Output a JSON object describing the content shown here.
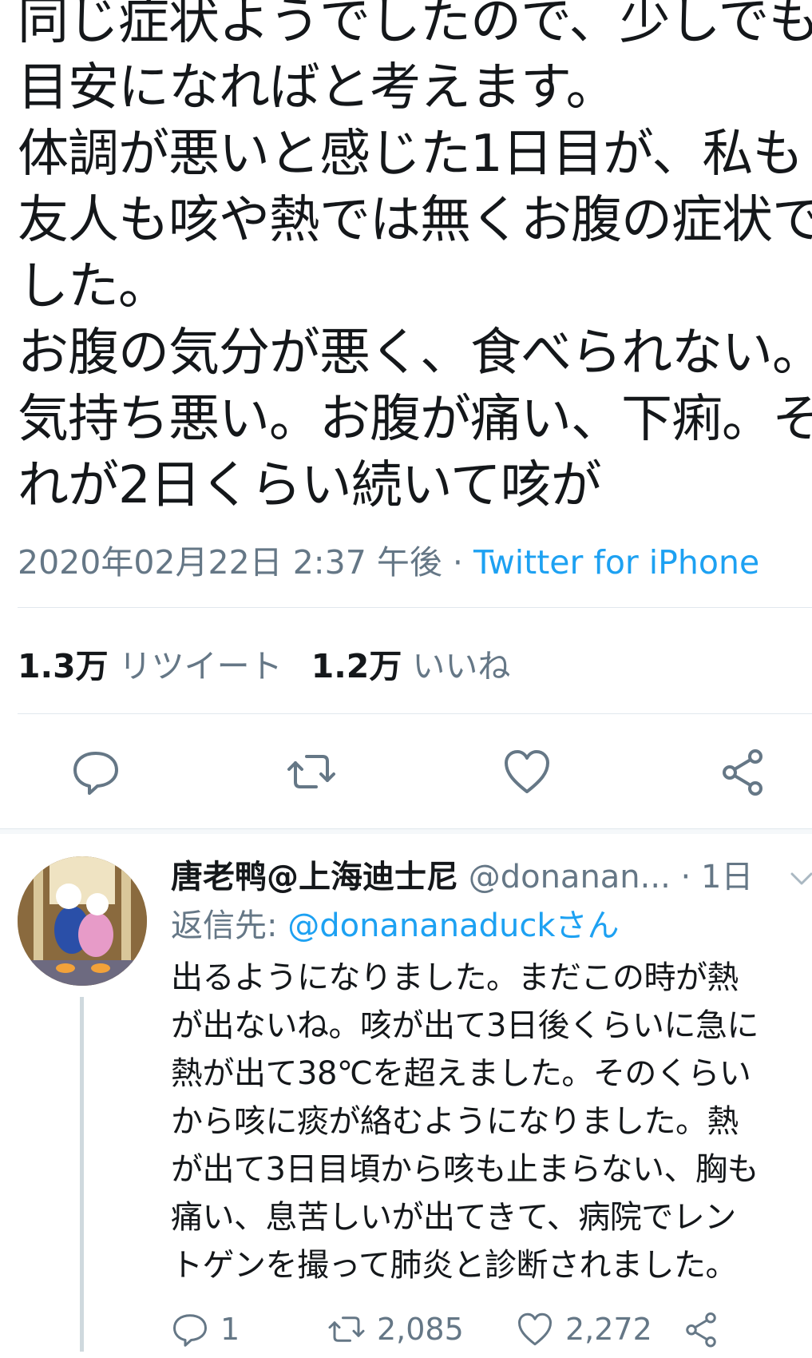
{
  "tweet": {
    "lines": [
      "同じ症状ようでしたので、少しでも",
      "目安になればと考えます。",
      "体調が悪いと感じた1日目が、私も",
      "友人も咳や熱では無くお腹の症状で",
      "した。",
      "お腹の気分が悪く、食べられない。",
      "気持ち悪い。お腹が痛い、下痢。そ",
      "れが2日くらい続いて咳が"
    ],
    "timestamp": "2020年02月22日 2:37 午後",
    "separator": " · ",
    "source": "Twitter for iPhone",
    "retweet_count": "1.3万",
    "retweet_label": "リツイート",
    "like_count": "1.2万",
    "like_label": "いいね"
  },
  "actions": [
    {
      "icon": "reply-icon"
    },
    {
      "icon": "retweet-icon"
    },
    {
      "icon": "like-icon"
    },
    {
      "icon": "share-icon"
    }
  ],
  "reply": {
    "name": "唐老鸭@上海迪士尼",
    "handle": "@donanan...",
    "time": " · 1日",
    "reply_to_prefix": "返信先: ",
    "reply_to_link": "@donananaduckさん",
    "body_lines": [
      "出るようになりました。まだこの時が熱",
      "が出ないね。咳が出て3日後くらいに急に",
      "熱が出て38℃を超えました。そのくらい",
      "から咳に痰が絡むようになりました。熱",
      "が出て3日目頃から咳も止まらない、胸も",
      "痛い、息苦しいが出てきて、病院でレン",
      "トゲンを撮って肺炎と診断されました。"
    ],
    "reply_count": "1",
    "retweet_count": "2,085",
    "like_count": "2,272"
  },
  "colors": {
    "link": "#1da1f2",
    "secondary_text": "#657786",
    "primary_text": "#14171a"
  }
}
